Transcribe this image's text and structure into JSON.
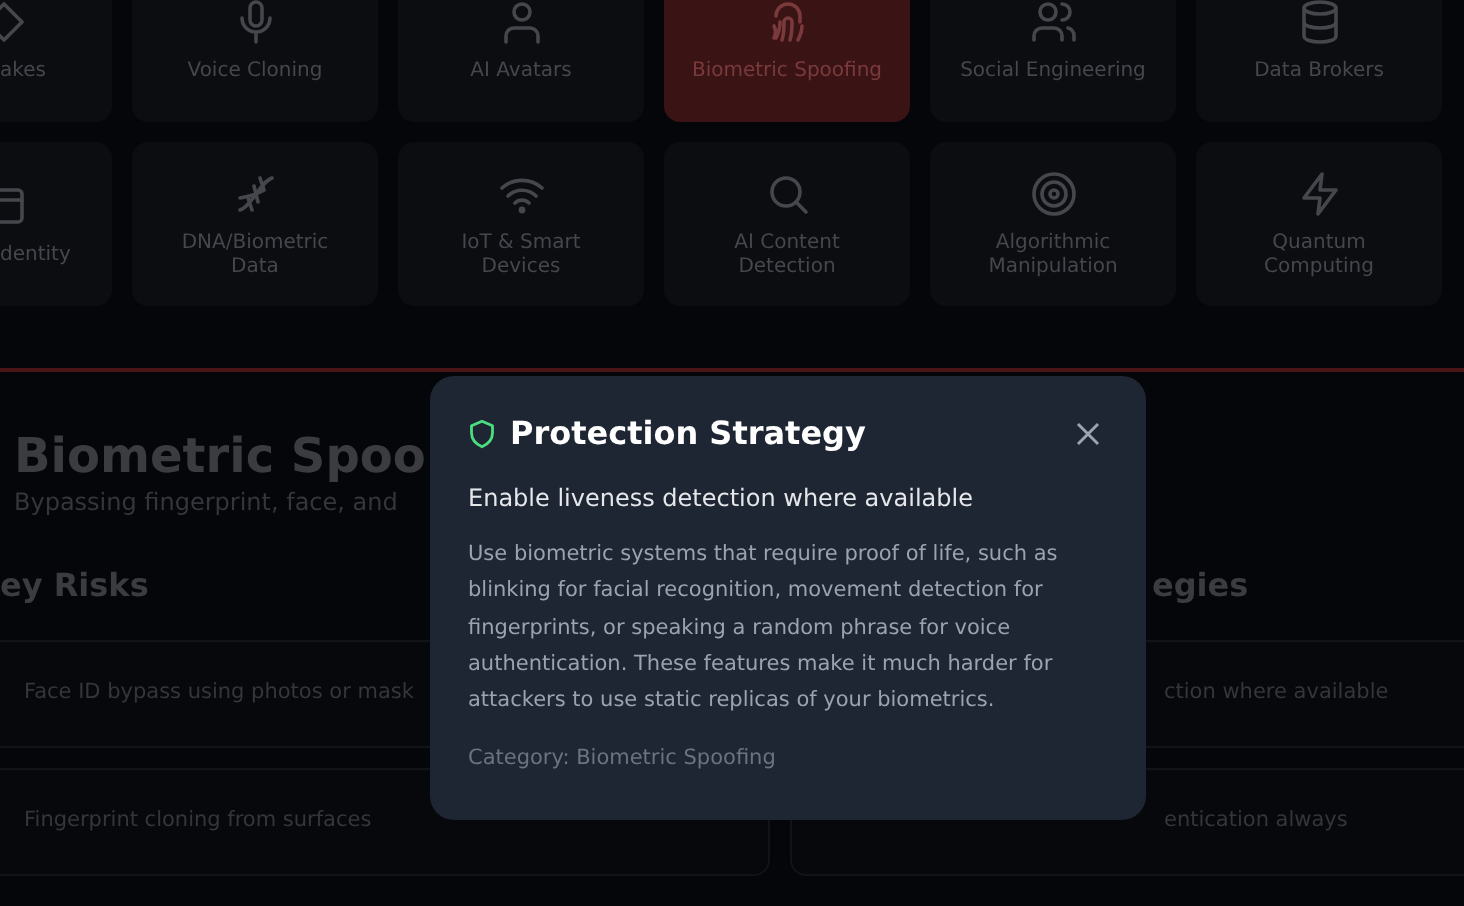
{
  "categories": [
    {
      "label": "akes",
      "selected": false
    },
    {
      "label": "Voice Cloning",
      "selected": false
    },
    {
      "label": "AI Avatars",
      "selected": false
    },
    {
      "label": "Biometric Spoofing",
      "selected": true
    },
    {
      "label": "Social Engineering",
      "selected": false
    },
    {
      "label": "Data Brokers",
      "selected": false
    },
    {
      "label": "dentity",
      "selected": false
    },
    {
      "label": "DNA/Biometric Data",
      "selected": false
    },
    {
      "label": "IoT & Smart Devices",
      "selected": false
    },
    {
      "label": "AI Content Detection",
      "selected": false
    },
    {
      "label": "Algorithmic Manipulation",
      "selected": false
    },
    {
      "label": "Quantum Computing",
      "selected": false
    }
  ],
  "section": {
    "title": "Biometric Spoo",
    "subtitle": "Bypassing fingerprint, face, and"
  },
  "risks": {
    "heading": "ey Risks",
    "items": [
      "Face ID bypass using photos or mask",
      "Fingerprint cloning from surfaces"
    ]
  },
  "strategies": {
    "heading": "egies",
    "items": [
      "ction where available",
      "entication always"
    ]
  },
  "modal": {
    "title": "Protection Strategy",
    "subtitle": "Enable liveness detection where available",
    "body": "Use biometric systems that require proof of life, such as blinking for facial recognition, movement detection for fingerprints, or speaking a random phrase for voice authentication. These features make it much harder for attackers to use static replicas of your biometrics.",
    "category": "Category: Biometric Spoofing"
  }
}
